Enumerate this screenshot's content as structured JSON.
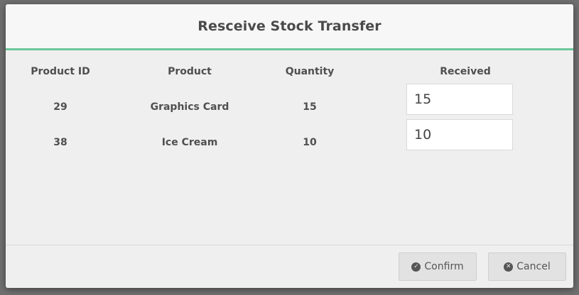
{
  "dialog": {
    "title": "Resceive Stock Transfer"
  },
  "table": {
    "headers": {
      "product_id": "Product ID",
      "product": "Product",
      "quantity": "Quantity",
      "received": "Received"
    },
    "rows": [
      {
        "product_id": "29",
        "product": "Graphics Card",
        "quantity": "15",
        "received": "15"
      },
      {
        "product_id": "38",
        "product": "Ice Cream",
        "quantity": "10",
        "received": "10"
      }
    ]
  },
  "footer": {
    "confirm_label": "Confirm",
    "cancel_label": "Cancel",
    "confirm_icon": "check-circle-icon",
    "cancel_icon": "times-circle-icon"
  },
  "colors": {
    "header_accent": "#6cc79a",
    "dialog_background": "#f0efef",
    "button_background": "#e3e2e2"
  }
}
